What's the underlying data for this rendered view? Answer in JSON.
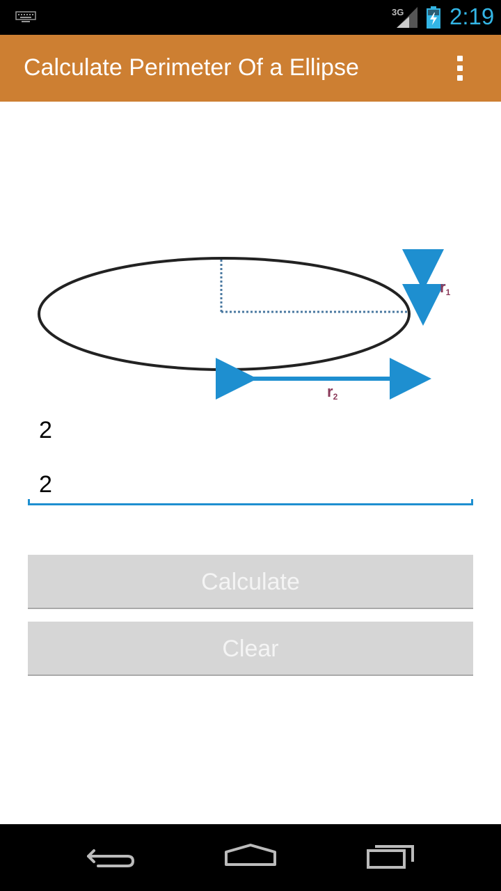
{
  "status_bar": {
    "time": "2:19",
    "network": "3G",
    "icons": [
      "keyboard-icon",
      "signal-3g-icon",
      "battery-charging-icon"
    ],
    "time_color": "#33b5e5"
  },
  "action_bar": {
    "title": "Calculate Perimeter Of a Ellipse",
    "menu_icon": "overflow-menu-icon",
    "background": "#cd7f32"
  },
  "diagram": {
    "label_r1": "r",
    "label_r1_sub": "1",
    "label_r2": "r",
    "label_r2_sub": "2",
    "arrow_color": "#1e8fd0",
    "label_color": "#8b3a5a"
  },
  "form": {
    "input_r1_value": "2",
    "input_r2_value": "2",
    "focus_color": "#1e8fd0"
  },
  "buttons": {
    "calculate_label": "Calculate",
    "clear_label": "Clear"
  },
  "nav_bar": {
    "icons": [
      "back-icon",
      "home-icon",
      "recent-apps-icon"
    ]
  }
}
